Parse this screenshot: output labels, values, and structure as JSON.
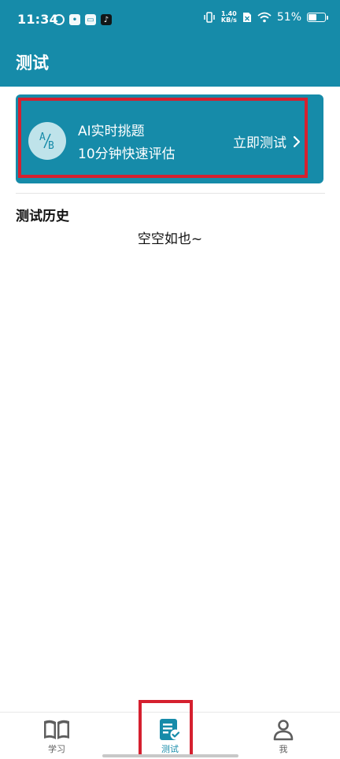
{
  "status_bar": {
    "time": "11:34",
    "net_speed_value": "1.40",
    "net_speed_unit": "KB/s",
    "battery": "51%",
    "battery_level": 0.51
  },
  "header": {
    "title": "测试"
  },
  "test_card": {
    "title": "AI实时挑题",
    "subtitle": "10分钟快速评估",
    "action_label": "立即测试",
    "icon": "ab-test-icon"
  },
  "history": {
    "title": "测试历史",
    "empty_text": "空空如也~"
  },
  "bottom_nav": {
    "items": [
      {
        "label": "学习",
        "icon": "book-icon",
        "active": false
      },
      {
        "label": "测试",
        "icon": "test-checklist-icon",
        "active": true
      },
      {
        "label": "我",
        "icon": "person-icon",
        "active": false
      }
    ]
  },
  "colors": {
    "primary": "#168BA9",
    "highlight": "#D5202F",
    "nav_inactive": "#5E5E5E"
  }
}
